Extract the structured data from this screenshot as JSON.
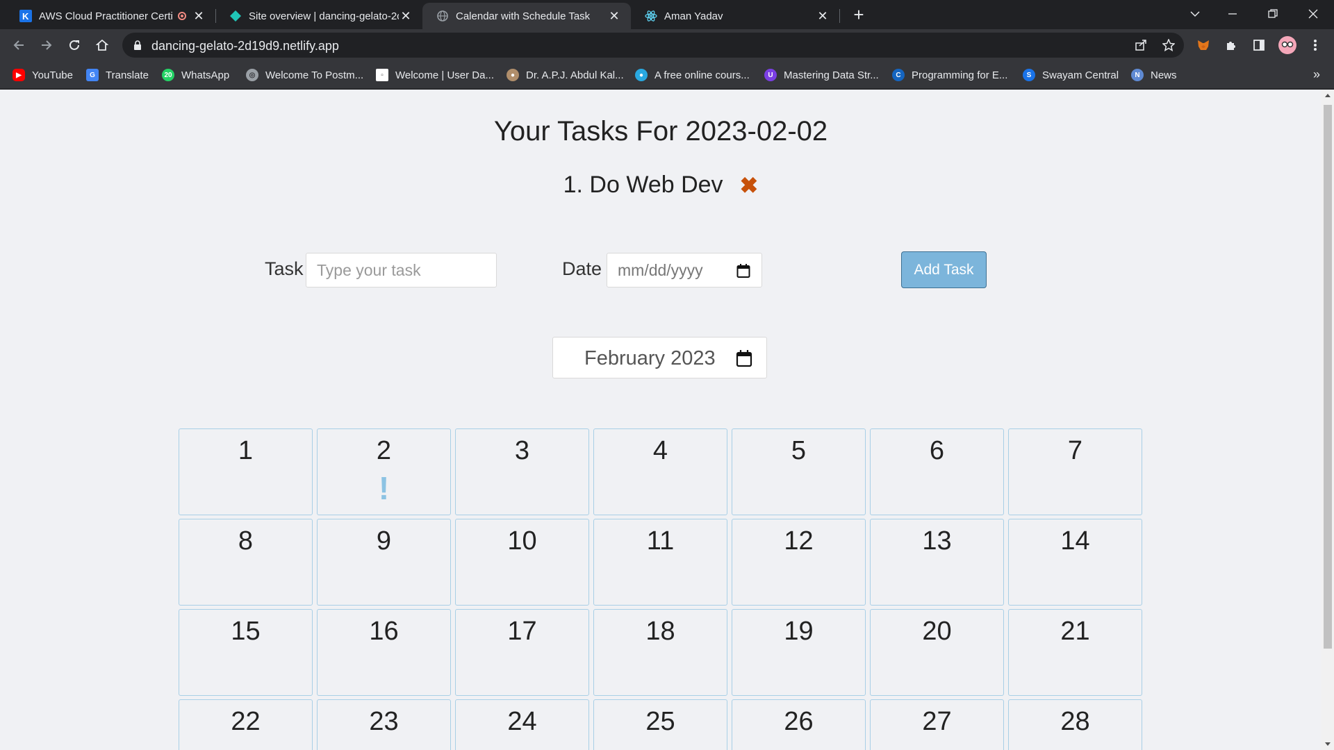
{
  "browser": {
    "tabs": [
      {
        "title": "AWS Cloud Practitioner Certi",
        "favicon": "k-icon"
      },
      {
        "title": "Site overview | dancing-gelato-2c",
        "favicon": "netlify-icon"
      },
      {
        "title": "Calendar with Schedule Task",
        "favicon": "globe-icon"
      },
      {
        "title": "Aman Yadav",
        "favicon": "react-icon"
      }
    ],
    "url": "dancing-gelato-2d19d9.netlify.app",
    "bookmarks": [
      {
        "label": "YouTube",
        "color": "#ff0000"
      },
      {
        "label": "Translate",
        "color": "#4285f4"
      },
      {
        "label": "WhatsApp",
        "color": "#25d366"
      },
      {
        "label": "Welcome To Postm...",
        "color": "#9aa0a6"
      },
      {
        "label": "Welcome | User Da...",
        "color": "#ffffff"
      },
      {
        "label": "Dr. A.P.J. Abdul Kal...",
        "color": "#b08e6b"
      },
      {
        "label": "A free online cours...",
        "color": "#29a8e0"
      },
      {
        "label": "Mastering Data Str...",
        "color": "#7b3fe4"
      },
      {
        "label": "Programming for E...",
        "color": "#1565c0"
      },
      {
        "label": "Swayam Central",
        "color": "#1a73e8"
      },
      {
        "label": "News",
        "color": "#5f8ad3"
      }
    ]
  },
  "page": {
    "heading": "Your Tasks For 2023-02-02",
    "tasks": [
      {
        "label": "1. Do Web Dev"
      }
    ],
    "form": {
      "task_label": "Task",
      "task_placeholder": "Type your task",
      "date_label": "Date",
      "date_placeholder": "mm/dd/yyyy",
      "add_button": "Add Task"
    },
    "month_picker": "February 2023",
    "calendar": {
      "days": [
        "1",
        "2",
        "3",
        "4",
        "5",
        "6",
        "7",
        "8",
        "9",
        "10",
        "11",
        "12",
        "13",
        "14",
        "15",
        "16",
        "17",
        "18",
        "19",
        "20",
        "21",
        "22",
        "23",
        "24",
        "25",
        "26",
        "27",
        "28"
      ],
      "marked_day": "2",
      "marker": "!"
    }
  },
  "colors": {
    "accent_button": "#7cb5db",
    "delete_icon": "#c7510a",
    "day_border": "#a8cfe6",
    "task_marker": "#8cc3e3"
  }
}
